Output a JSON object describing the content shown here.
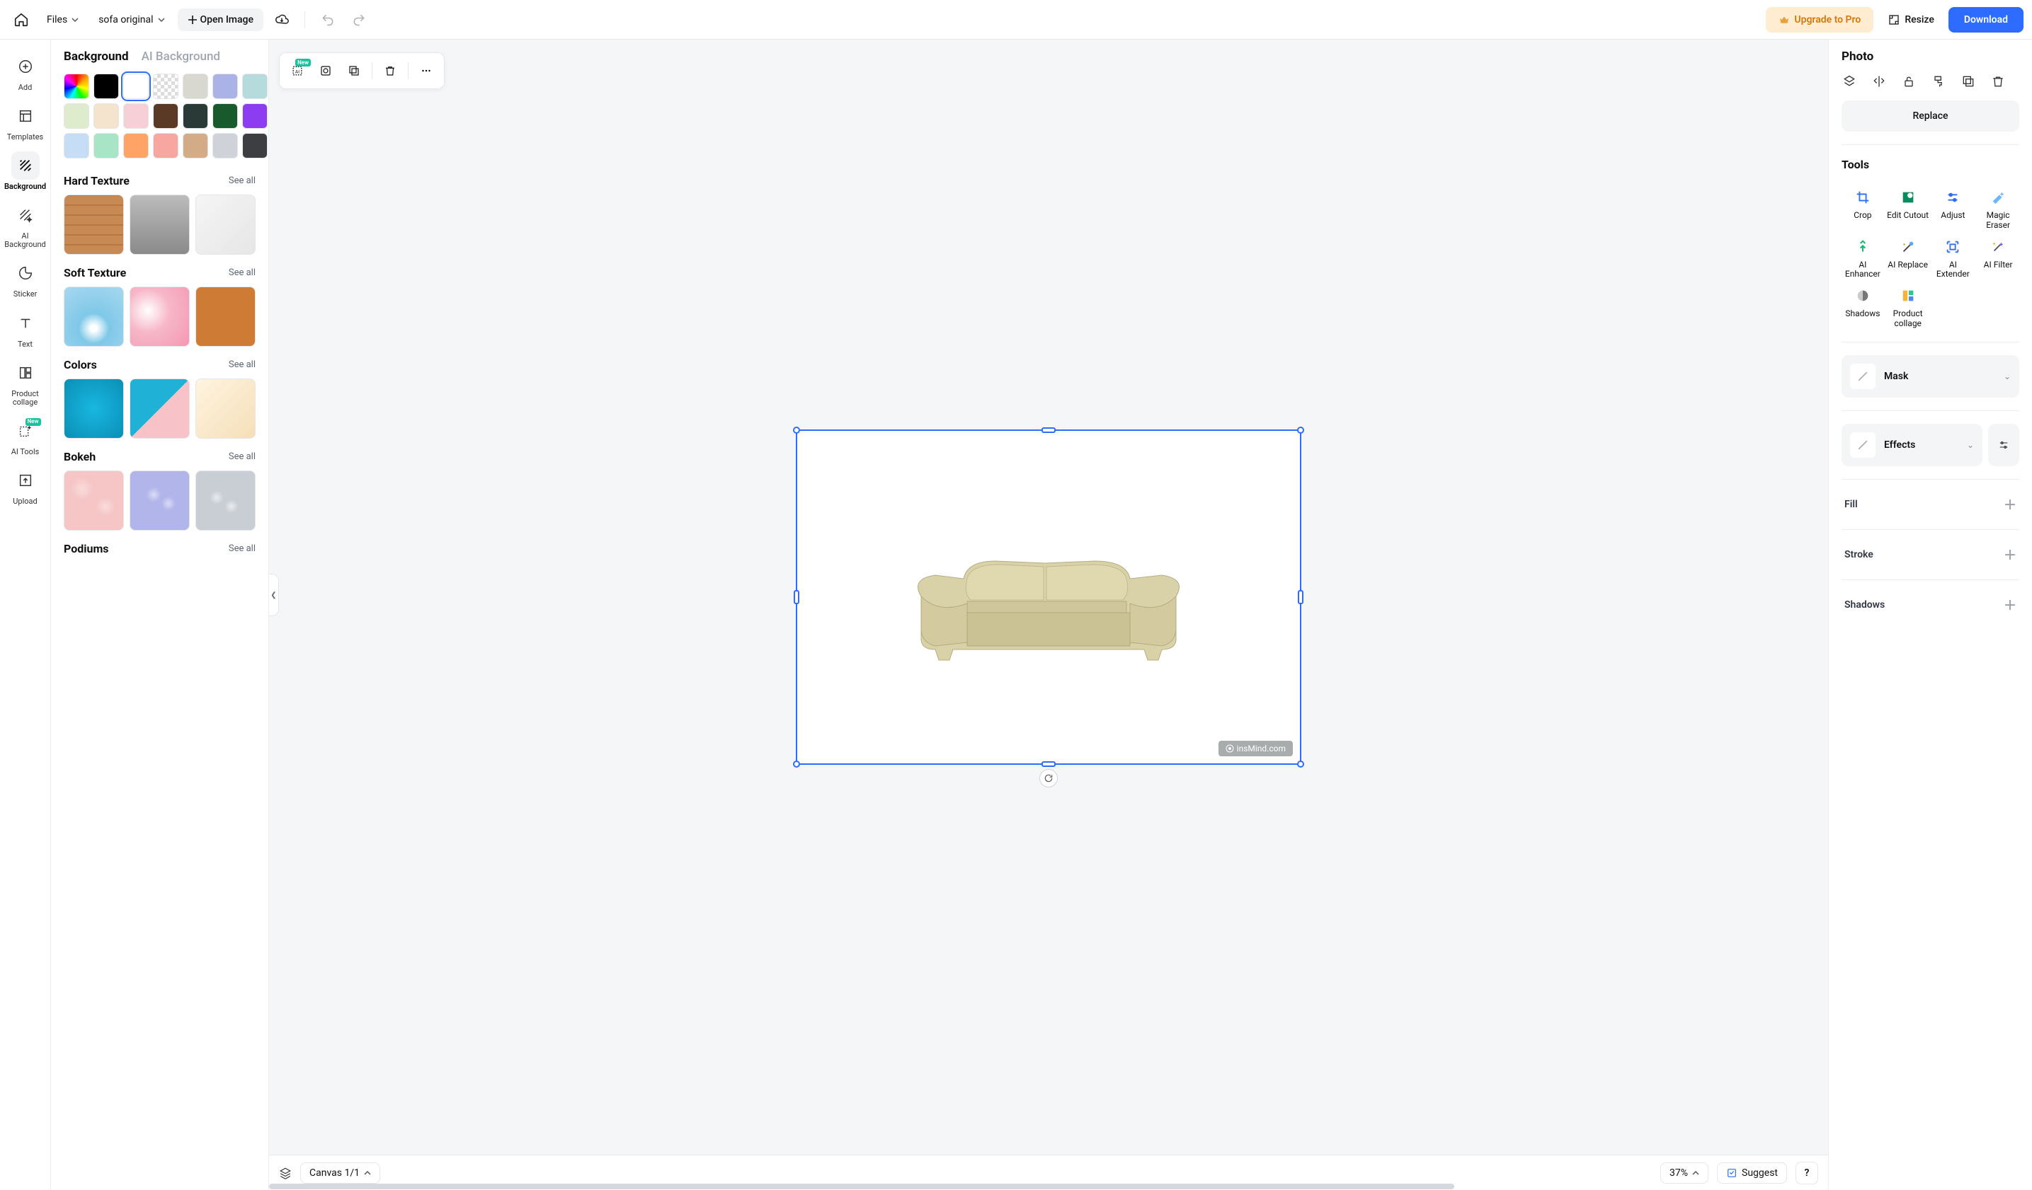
{
  "topbar": {
    "files_label": "Files",
    "filename": "sofa original",
    "open_image": "Open Image",
    "upgrade": "Upgrade to Pro",
    "resize": "Resize",
    "download": "Download"
  },
  "rail": {
    "items": [
      {
        "label": "Add"
      },
      {
        "label": "Templates"
      },
      {
        "label": "Background"
      },
      {
        "label": "AI Background"
      },
      {
        "label": "Sticker"
      },
      {
        "label": "Text"
      },
      {
        "label": "Product collage"
      },
      {
        "label": "AI Tools",
        "new": "New"
      },
      {
        "label": "Upload"
      }
    ]
  },
  "bg_panel": {
    "tab_active": "Background",
    "tab_ai": "AI Background",
    "swatches": [
      "rainbow",
      "#000000",
      "#ffffff",
      "checker",
      "#d8d8d0",
      "#abb2e8",
      "#b6dbdc",
      "#dfebcd",
      "#f5e4cd",
      "#f6d0d6",
      "#5a3a25",
      "#2a3a36",
      "#195a2c",
      "#8c3df2",
      "#c5def5",
      "#a8e4c6",
      "#ffa366",
      "#f7a6a0",
      "#d4ab87",
      "#cfd2d8",
      "#3c3e41"
    ],
    "see_all": "See all",
    "cats": [
      {
        "title": "Hard Texture"
      },
      {
        "title": "Soft Texture"
      },
      {
        "title": "Colors"
      },
      {
        "title": "Bokeh"
      },
      {
        "title": "Podiums"
      }
    ]
  },
  "float_toolbar": {
    "new_tag": "New"
  },
  "canvas": {
    "watermark": "insMind.com"
  },
  "bottom": {
    "canvas_label": "Canvas 1/1",
    "zoom": "37%",
    "suggest": "Suggest",
    "help": "?"
  },
  "right": {
    "title": "Photo",
    "replace": "Replace",
    "tools_label": "Tools",
    "tools": [
      {
        "label": "Crop"
      },
      {
        "label": "Edit Cutout"
      },
      {
        "label": "Adjust"
      },
      {
        "label": "Magic Eraser"
      },
      {
        "label": "AI Enhancer"
      },
      {
        "label": "AI Replace"
      },
      {
        "label": "AI Extender"
      },
      {
        "label": "AI Filter"
      },
      {
        "label": "Shadows"
      },
      {
        "label": "Product collage"
      }
    ],
    "mask": "Mask",
    "effects": "Effects",
    "fill": "Fill",
    "stroke": "Stroke",
    "shadows": "Shadows"
  }
}
